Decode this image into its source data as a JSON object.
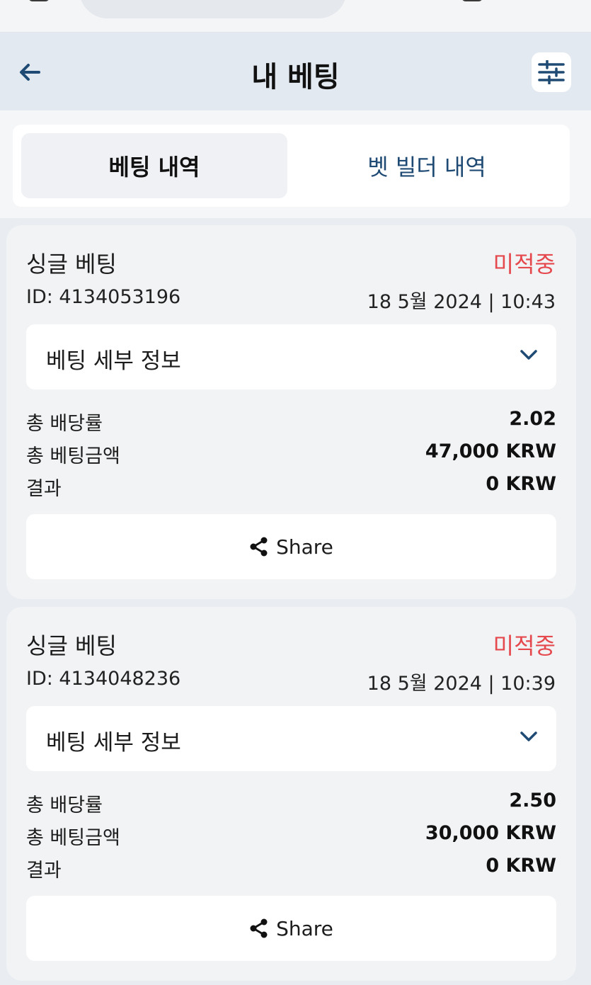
{
  "colors": {
    "accent": "#1e4a74",
    "status_red": "#e5484d",
    "header_bg": "#e2e9f0",
    "card_bg": "#f1f3f5"
  },
  "header": {
    "title": "내 베팅",
    "back_icon": "arrow-left-icon",
    "filter_icon": "sliders-icon"
  },
  "tabs": [
    {
      "label": "베팅 내역",
      "active": true
    },
    {
      "label": "벳 빌더 내역",
      "active": false
    }
  ],
  "bets": [
    {
      "type": "싱글 베팅",
      "status": "미적중",
      "id": "ID: 4134053196",
      "datetime": "18 5월 2024 | 10:43",
      "details_label": "베팅 세부 정보",
      "rows": [
        {
          "label": "총 배당률",
          "value": "2.02"
        },
        {
          "label": "총 베팅금액",
          "value": "47,000 KRW"
        },
        {
          "label": "결과",
          "value": "0 KRW"
        }
      ],
      "share_label": "Share"
    },
    {
      "type": "싱글 베팅",
      "status": "미적중",
      "id": "ID: 4134048236",
      "datetime": "18 5월 2024 | 10:39",
      "details_label": "베팅 세부 정보",
      "rows": [
        {
          "label": "총 배당률",
          "value": "2.50"
        },
        {
          "label": "총 베팅금액",
          "value": "30,000 KRW"
        },
        {
          "label": "결과",
          "value": "0 KRW"
        }
      ],
      "share_label": "Share"
    }
  ]
}
